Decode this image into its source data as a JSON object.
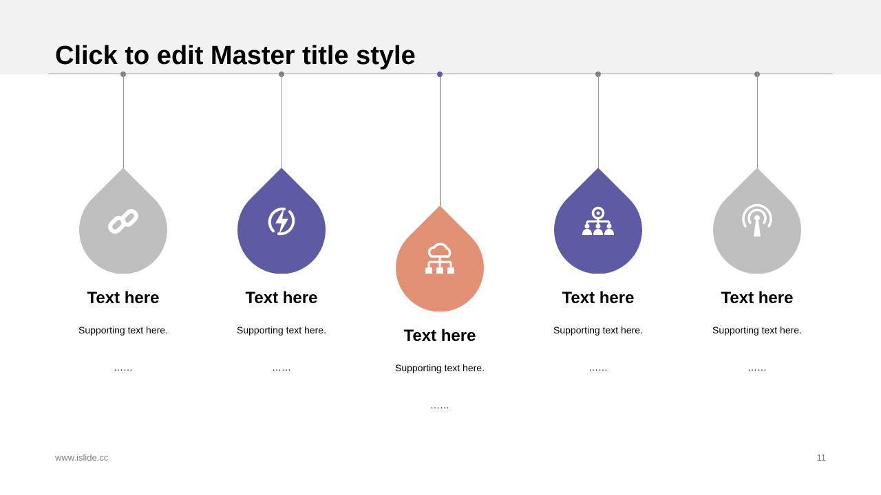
{
  "slide": {
    "title": "Click to edit Master title style",
    "footer_url": "www.islide.cc",
    "page_number": "11"
  },
  "colors": {
    "gray": "#bfbfbf",
    "purple": "#5e5ba5",
    "orange": "#e29174",
    "line": "#9a9a9a",
    "pin_gray": "#7f7f7f"
  },
  "items": [
    {
      "title": "Text here",
      "support": "Supporting text here.",
      "dots": "……",
      "icon": "link-icon",
      "color": "gray"
    },
    {
      "title": "Text here",
      "support": "Supporting text here.",
      "dots": "……",
      "icon": "lightning-icon",
      "color": "purple"
    },
    {
      "title": "Text here",
      "support": "Supporting text here.",
      "dots": "……",
      "icon": "cloud-network-icon",
      "color": "orange"
    },
    {
      "title": "Text here",
      "support": "Supporting text here.",
      "dots": "……",
      "icon": "team-hierarchy-icon",
      "color": "purple"
    },
    {
      "title": "Text here",
      "support": "Supporting text here.",
      "dots": "……",
      "icon": "broadcast-antenna-icon",
      "color": "gray"
    }
  ]
}
